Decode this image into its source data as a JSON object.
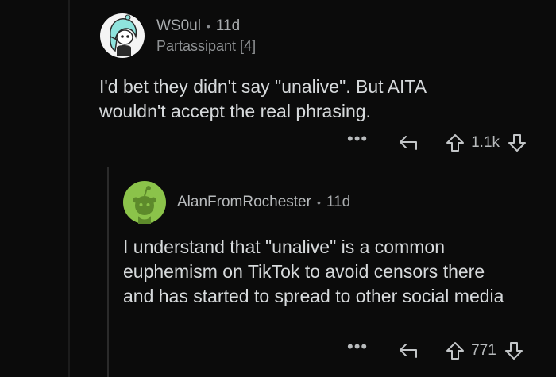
{
  "comments": [
    {
      "username": "WS0ul",
      "separator": "•",
      "age": "11d",
      "flair": "Partassipant [4]",
      "body": "I'd bet they didn't say \"unalive\". But AITA wouldn't accept the real phrasing.",
      "actions": {
        "more": "•••",
        "vote_count": "1.1k",
        "reply_icon": "reply-arrow-icon",
        "upvote_icon": "upvote-arrow-icon",
        "downvote_icon": "downvote-arrow-icon"
      },
      "avatar_icon": "snoo-avatar-teal-hair"
    },
    {
      "username": "AlanFromRochester",
      "separator": "•",
      "age": "11d",
      "body": "I understand that \"unalive\" is a common euphemism on TikTok to avoid censors there and has started to spread to other social media",
      "actions": {
        "more": "•••",
        "vote_count": "771",
        "reply_icon": "reply-arrow-icon",
        "upvote_icon": "upvote-arrow-icon",
        "downvote_icon": "downvote-arrow-icon"
      },
      "avatar_icon": "snoo-avatar-default-green"
    }
  ],
  "colors": {
    "background": "#0b0b0b",
    "text": "#d7dadc",
    "meta": "#a8abad",
    "default_avatar": "#8bc34a"
  }
}
